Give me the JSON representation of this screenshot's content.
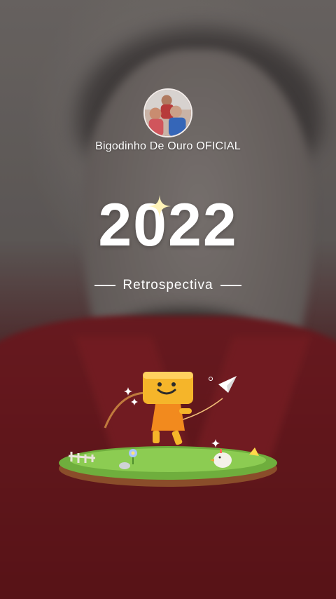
{
  "profile": {
    "username": "Bigodinho De Ouro OFICIAL"
  },
  "recap": {
    "year": "2022",
    "subtitle": "Retrospectiva"
  },
  "colors": {
    "text": "#ffffff",
    "shirt": "#7e1f26",
    "grass": "#6fae3d",
    "mascot": "#f5b52a"
  },
  "icons": {
    "year_sparkle": "sparkle-icon",
    "mascot": "smiley-box-mascot",
    "paper_plane": "paper-plane-icon"
  }
}
